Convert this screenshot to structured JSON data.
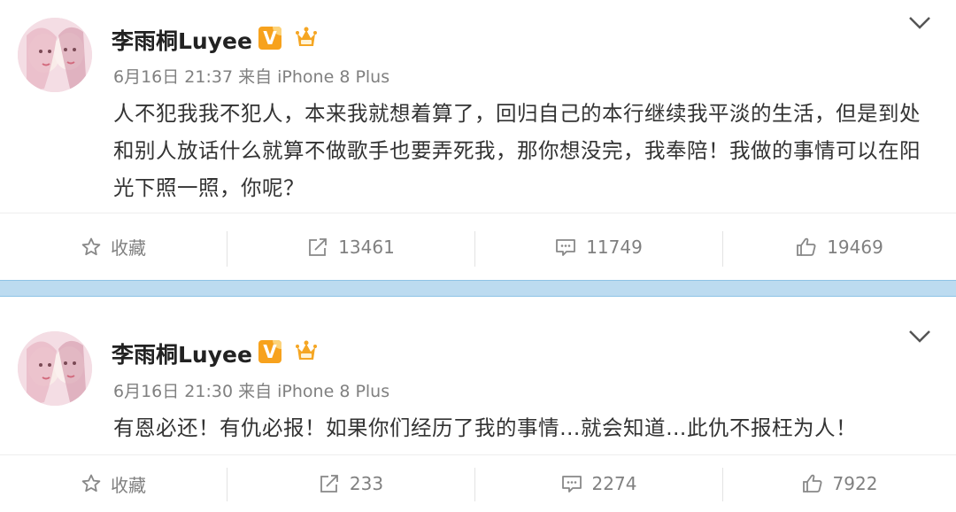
{
  "posts": [
    {
      "username": "李雨桐Luyee",
      "verified_badge": "V",
      "meta": "6月16日 21:37 来自 iPhone 8 Plus",
      "content": "人不犯我我不犯人，本来我就想着算了，回归自己的本行继续我平淡的生活，但是到处和别人放话什么就算不做歌手也要弄死我，那你想没完，我奉陪！我做的事情可以在阳光下照一照，你呢？",
      "actions": {
        "favorite_label": "收藏",
        "forward_count": "13461",
        "comment_count": "11749",
        "like_count": "19469"
      }
    },
    {
      "username": "李雨桐Luyee",
      "verified_badge": "V",
      "meta": "6月16日 21:30 来自 iPhone 8 Plus",
      "content": "有恩必还！有仇必报！如果你们经历了我的事情…就会知道…此仇不报枉为人！",
      "actions": {
        "favorite_label": "收藏",
        "forward_count": "233",
        "comment_count": "2274",
        "like_count": "7922"
      }
    }
  ],
  "colors": {
    "badge": "#f7a21d",
    "divider": "#bcdbf0",
    "muted_text": "#808080"
  },
  "icons": [
    "star-icon",
    "forward-icon",
    "comment-icon",
    "thumbs-up-icon",
    "chevron-down-icon",
    "crown-badge-icon"
  ]
}
